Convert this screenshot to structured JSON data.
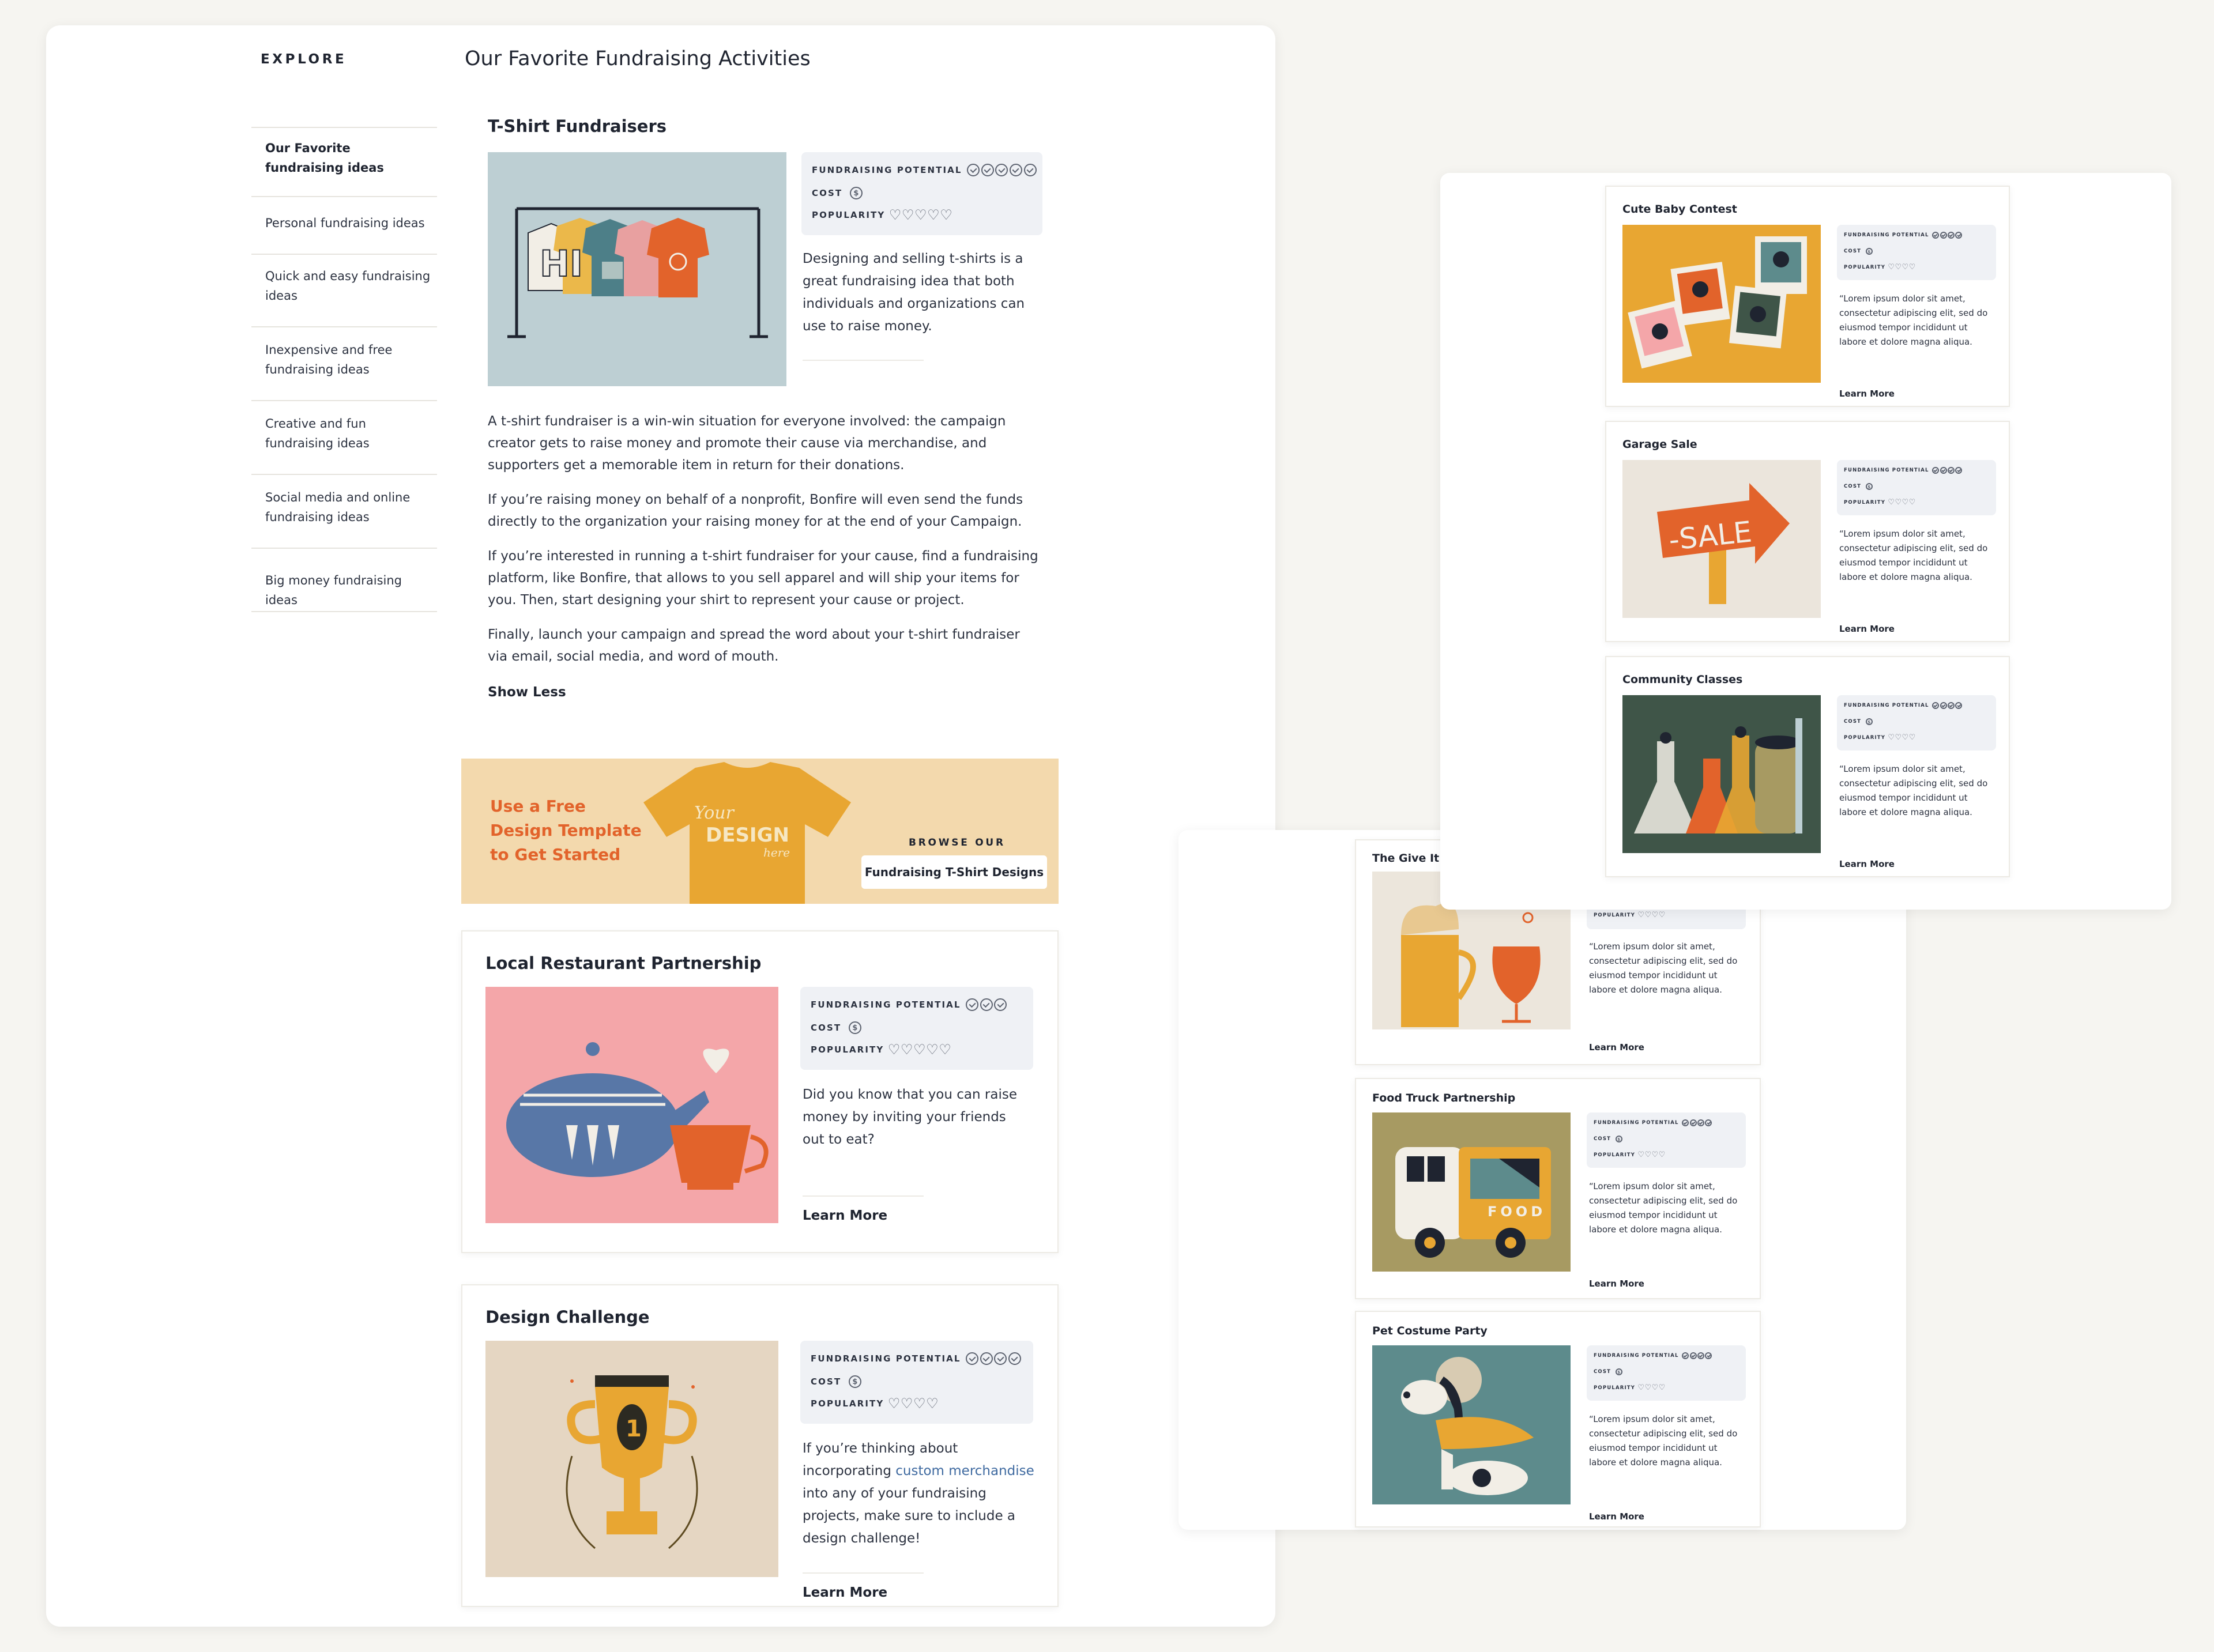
{
  "explore": {
    "heading": "EXPLORE",
    "items": [
      "Our Favorite fundraising ideas",
      "Personal fundraising ideas",
      "Quick and easy fundraising ideas",
      "Inexpensive and free fundraising ideas",
      "Creative and fun fundraising ideas",
      "Social media and online fundraising ideas",
      "Big money fundraising ideas"
    ]
  },
  "page": {
    "title": "Our Favorite Fundraising Activities"
  },
  "labels": {
    "potential": "FUNDRAISING POTENTIAL",
    "cost": "COST",
    "popularity": "POPULARITY",
    "cost_symbol": "$",
    "learn_more": "Learn More"
  },
  "tshirt": {
    "title": "T-Shirt Fundraisers",
    "summary": "Designing and selling t-shirts is a great fundraising idea that both individuals and organizations can use to raise money.",
    "potential": 5,
    "cost": 1,
    "popularity": 5,
    "paragraphs": [
      "A t-shirt fundraiser is a win-win situation for everyone involved: the campaign creator gets to raise money and promote their cause via merchandise, and supporters get a memorable item in return for their donations.",
      "If you’re raising money on behalf of a nonprofit, Bonfire will even send the funds directly to the organization your raising money for at the end of your Campaign.",
      "If you’re interested in running a t-shirt fundraiser for your cause, find a fundraising platform, like Bonfire, that allows to you sell apparel and will ship your items for you. Then, start designing your shirt to represent your cause or project.",
      "Finally, launch your campaign and spread the word about your t-shirt fundraiser via email, social media, and word of mouth."
    ],
    "show_less": "Show Less",
    "shirt_text": "HI"
  },
  "banner": {
    "line1": "Use a Free",
    "line2": "Design Template",
    "line3": "to Get Started",
    "shirt_text_1": "Your",
    "shirt_text_2": "DESIGN",
    "shirt_text_3": "here",
    "browse": "BROWSE OUR",
    "button": "Fundraising T-Shirt Designs",
    "bg": "#f3d9ad",
    "accent": "#e2632b"
  },
  "restaurant": {
    "title": "Local Restaurant Partnership",
    "summary": "Did you know that you can raise money by inviting your friends out to eat?",
    "potential": 3,
    "cost": 1,
    "popularity": 5
  },
  "design": {
    "title": "Design Challenge",
    "summary_pre": "If you’re thinking about incorporating ",
    "summary_link": "custom merchandise",
    "summary_post": " into any of your fundraising projects, make sure to include a design challenge!",
    "potential": 4,
    "cost": 1,
    "popularity": 4,
    "trophy_number": "1"
  },
  "right_cards": [
    {
      "title": "Cute Baby Contest",
      "potential": 4,
      "popularity": 4,
      "lorem": "“Lorem ipsum dolor sit amet, consectetur adipiscing elit, sed do eiusmod tempor incididunt ut labore et dolore magna aliqua."
    },
    {
      "title": "Garage Sale",
      "potential": 4,
      "popularity": 4,
      "sale_text": "-SALE",
      "lorem": "“Lorem ipsum dolor sit amet, consectetur adipiscing elit, sed do eiusmod tempor incididunt ut labore et dolore magna aliqua."
    },
    {
      "title": "Community Classes",
      "potential": 4,
      "popularity": 4,
      "lorem": "“Lorem ipsum dolor sit amet, consectetur adipiscing elit, sed do eiusmod tempor incididunt ut labore et dolore magna aliqua."
    }
  ],
  "middle_cards": [
    {
      "title": "The Give It U",
      "popularity": 4,
      "lorem": "“Lorem ipsum dolor sit amet, consectetur adipiscing elit, sed do eiusmod tempor incididunt ut labore et dolore magna aliqua."
    },
    {
      "title": "Food Truck Partnership",
      "potential": 4,
      "popularity": 4,
      "truck_text": "FOOD",
      "lorem": "“Lorem ipsum dolor sit amet, consectetur adipiscing elit, sed do eiusmod tempor incididunt ut labore et dolore magna aliqua."
    },
    {
      "title": "Pet Costume Party",
      "potential": 4,
      "popularity": 4,
      "lorem": "“Lorem ipsum dolor sit amet, consectetur adipiscing elit, sed do eiusmod tempor incididunt ut labore et dolore magna aliqua."
    }
  ],
  "colors": {
    "tshirt_bg": "#bdcfd3",
    "restaurant_bg": "#f4a6a9",
    "design_bg": "#e5d6c2",
    "baby_bg": "#e8a632",
    "garage_bg": "#ebe5dc",
    "classes_bg": "#3f5548",
    "give_bg": "#ece6dc",
    "truck_bg": "#a79a62",
    "pet_bg": "#5d8b8c",
    "link": "#3f6aa0"
  }
}
